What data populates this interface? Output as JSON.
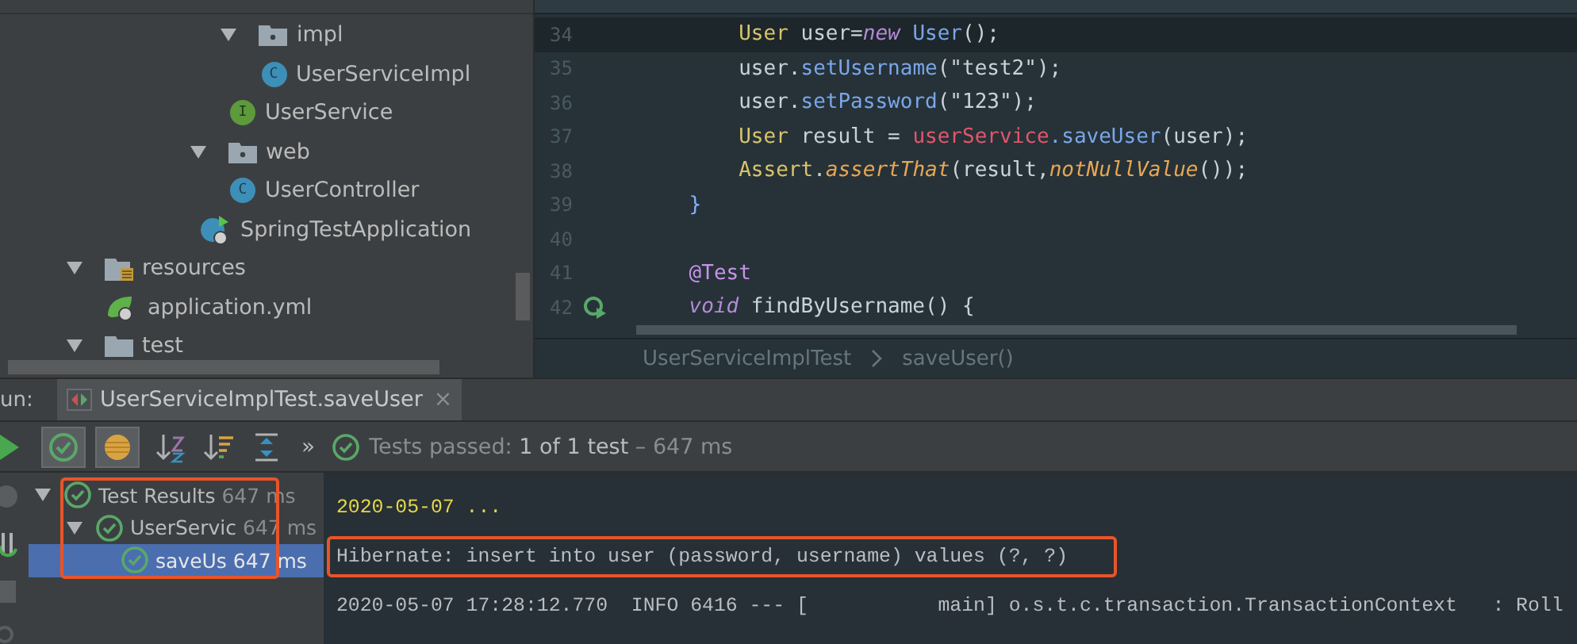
{
  "project_tree": [
    {
      "label": "impl",
      "kind": "folder",
      "expanded": true,
      "children": [
        {
          "label": "UserServiceImpl",
          "kind": "class",
          "badge": "C"
        }
      ]
    },
    {
      "label": "UserService",
      "kind": "interface",
      "badge": "I"
    },
    {
      "label": "web",
      "kind": "folder",
      "expanded": true,
      "children": [
        {
          "label": "UserController",
          "kind": "class",
          "badge": "C"
        }
      ]
    },
    {
      "label": "SpringTestApplication",
      "kind": "spring_app"
    },
    {
      "label": "resources",
      "kind": "resource_folder",
      "expanded": true,
      "children": [
        {
          "label": "application.yml",
          "kind": "yml"
        }
      ]
    },
    {
      "label": "test",
      "kind": "folder",
      "expanded": true
    }
  ],
  "editor": {
    "lines": [
      {
        "number": "34",
        "current": true,
        "kind": "statement",
        "tokens": [
          {
            "t": "User",
            "kind": "type"
          },
          {
            "t": " user=",
            "kind": "plain"
          },
          {
            "t": "new",
            "kind": "keyword"
          },
          {
            "t": " User",
            "kind": "method"
          },
          {
            "t": "();",
            "kind": "plain"
          }
        ]
      },
      {
        "number": "35",
        "current": false,
        "kind": "statement",
        "tokens": [
          {
            "t": "user.",
            "kind": "plain"
          },
          {
            "t": "setUsername",
            "kind": "method"
          },
          {
            "t": "(\"test2\");",
            "kind": "plain"
          }
        ]
      },
      {
        "number": "36",
        "current": false,
        "kind": "statement",
        "tokens": [
          {
            "t": "user.",
            "kind": "plain"
          },
          {
            "t": "setPassword",
            "kind": "method"
          },
          {
            "t": "(\"123\");",
            "kind": "plain"
          }
        ]
      },
      {
        "number": "37",
        "current": false,
        "kind": "statement",
        "tokens": [
          {
            "t": "User",
            "kind": "type"
          },
          {
            "t": " result = ",
            "kind": "plain"
          },
          {
            "t": "userService",
            "kind": "field"
          },
          {
            "t": ".saveUser",
            "kind": "method"
          },
          {
            "t": "(user);",
            "kind": "plain"
          }
        ]
      },
      {
        "number": "38",
        "current": false,
        "kind": "statement",
        "tokens": [
          {
            "t": "Assert",
            "kind": "type"
          },
          {
            "t": ".",
            "kind": "plain"
          },
          {
            "t": "assertThat",
            "kind": "static"
          },
          {
            "t": "(result,",
            "kind": "plain"
          },
          {
            "t": "notNullValue",
            "kind": "static"
          },
          {
            "t": "());",
            "kind": "plain"
          }
        ]
      },
      {
        "number": "39",
        "current": false,
        "kind": "member",
        "tokens": [
          {
            "t": "}",
            "kind": "brace"
          }
        ]
      },
      {
        "number": "40",
        "current": false
      },
      {
        "number": "41",
        "current": false,
        "kind": "member",
        "tokens": [
          {
            "t": "@Test",
            "kind": "annotation"
          }
        ]
      },
      {
        "number": "42",
        "current": false,
        "kind": "member",
        "run_marker": true,
        "tokens": [
          {
            "t": "void",
            "kind": "keyword"
          },
          {
            "t": " findByUsername",
            "kind": "plain"
          },
          {
            "t": "() {",
            "kind": "plain"
          }
        ]
      }
    ],
    "breadcrumbs": [
      "UserServiceImplTest",
      "saveUser()"
    ]
  },
  "run_panel": {
    "label": "un:",
    "tab": {
      "title": "UserServiceImplTest.saveUser",
      "close": "×"
    },
    "toolbar": {
      "show_passed": true,
      "show_ignored": true,
      "more": "»"
    },
    "status": {
      "prefix": "Tests passed: ",
      "count": "1 of 1 test",
      "suffix": " – 647 ms"
    },
    "results": [
      {
        "label": "Test Results",
        "time": "647 ms",
        "selected": false,
        "children": [
          {
            "label": "UserServic",
            "time": "647 ms",
            "selected": false,
            "children": [
              {
                "label": "saveUs",
                "time": "647 ms",
                "selected": true
              }
            ]
          }
        ]
      }
    ],
    "console": [
      {
        "text": "2020-05-07 ...",
        "kind": "date",
        "highlighted": false
      },
      {
        "text": "Hibernate: insert into user (password, username) values (?, ?)",
        "kind": "log",
        "highlighted": true
      },
      {
        "text": "2020-05-07 17:28:12.770  INFO 6416 --- [           main] o.s.t.c.transaction.TransactionContext   : Roll",
        "kind": "log",
        "highlighted": false
      }
    ]
  }
}
